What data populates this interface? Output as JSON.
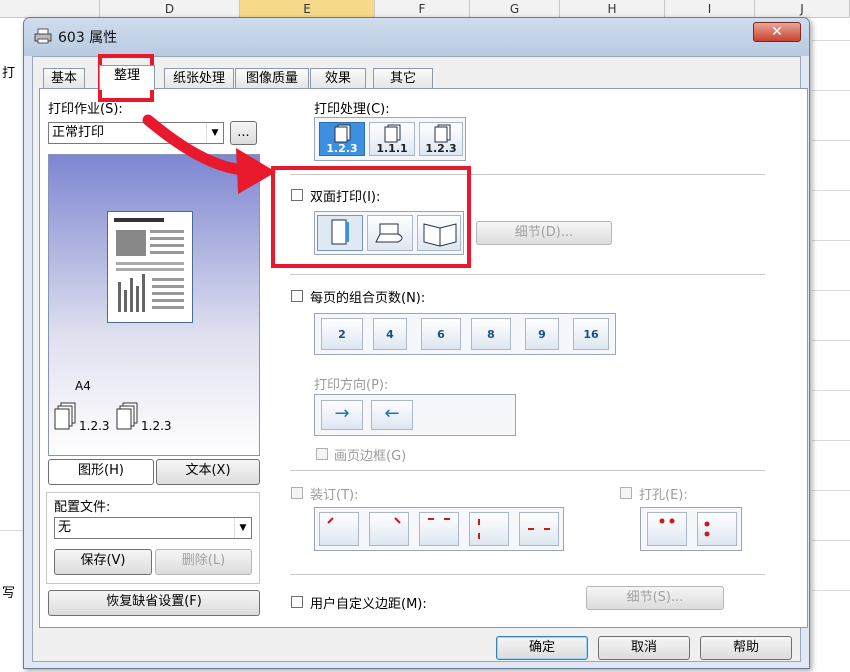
{
  "excel": {
    "columns": [
      "D",
      "E",
      "F",
      "G",
      "H",
      "I",
      "J"
    ],
    "left_edge_texts": [
      "打",
      "写"
    ]
  },
  "dialog": {
    "title": "603 属性",
    "close_symbol": "✕",
    "tabs": [
      "基本",
      "整理",
      "纸张处理",
      "图像质量",
      "效果",
      "其它"
    ],
    "active_tab": "整理",
    "job": {
      "label": "打印作业(S):",
      "value": "正常打印",
      "more_button": "..."
    },
    "preview": {
      "paper_size": "A4",
      "collate_label_1": "1.2.3",
      "collate_label_2": "1.2.3"
    },
    "view_buttons": {
      "graphic": "图形(H)",
      "text": "文本(X)"
    },
    "profile": {
      "label": "配置文件:",
      "value": "无",
      "save_button": "保存(V)",
      "delete_button": "删除(L)",
      "restore_button": "恢复缺省设置(F)"
    },
    "print_processing": {
      "label": "打印处理(C):",
      "options": [
        "1.2.3",
        "1.1.1",
        "1.2.3"
      ],
      "selected_index": 0
    },
    "duplex": {
      "label": "双面打印(I):",
      "checked": false,
      "detail_button": "细节(D)..."
    },
    "nup": {
      "label": "每页的组合页数(N):",
      "checked": false,
      "options": [
        "2",
        "4",
        "6",
        "8",
        "9",
        "16"
      ],
      "direction_label": "打印方向(P):",
      "direction_arrows": [
        "→",
        "←"
      ],
      "border_label": "画页边框(G)"
    },
    "staple": {
      "label": "装订(T):",
      "checked": false
    },
    "punch": {
      "label": "打孔(E):",
      "checked": false
    },
    "margin": {
      "label": "用户自定义边距(M):",
      "checked": false,
      "detail_button": "细节(S)..."
    },
    "footer": {
      "ok": "确定",
      "cancel": "取消",
      "help": "帮助"
    },
    "annotation_color": "#e8192c"
  }
}
